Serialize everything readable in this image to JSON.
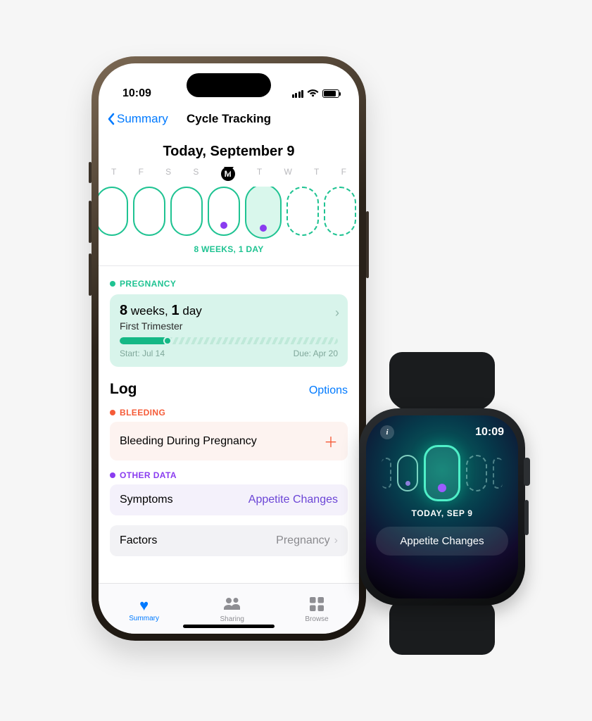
{
  "phone": {
    "status": {
      "time": "10:09"
    },
    "nav": {
      "back": "Summary",
      "title": "Cycle Tracking"
    },
    "today_heading": "Today, September 9",
    "week": {
      "days": [
        "T",
        "F",
        "S",
        "S",
        "M",
        "T",
        "W",
        "T",
        "F"
      ],
      "selected_index": 4,
      "gestation_caption": "8 WEEKS, 1 DAY"
    },
    "pregnancy": {
      "section_label": "PREGNANCY",
      "weeks_num": "8",
      "weeks_unit": "weeks,",
      "days_num": "1",
      "days_unit": "day",
      "trimester": "First Trimester",
      "start_label": "Start: Jul 14",
      "due_label": "Due: Apr 20"
    },
    "log": {
      "heading": "Log",
      "options": "Options",
      "bleeding_label": "BLEEDING",
      "bleeding_row": "Bleeding During Pregnancy",
      "other_label": "OTHER DATA",
      "symptoms_row": "Symptoms",
      "symptoms_value": "Appetite Changes",
      "factors_row": "Factors",
      "factors_value": "Pregnancy"
    },
    "tabs": {
      "summary": "Summary",
      "sharing": "Sharing",
      "browse": "Browse"
    }
  },
  "watch": {
    "time": "10:09",
    "date": "TODAY, SEP 9",
    "row": "Appetite Changes"
  }
}
